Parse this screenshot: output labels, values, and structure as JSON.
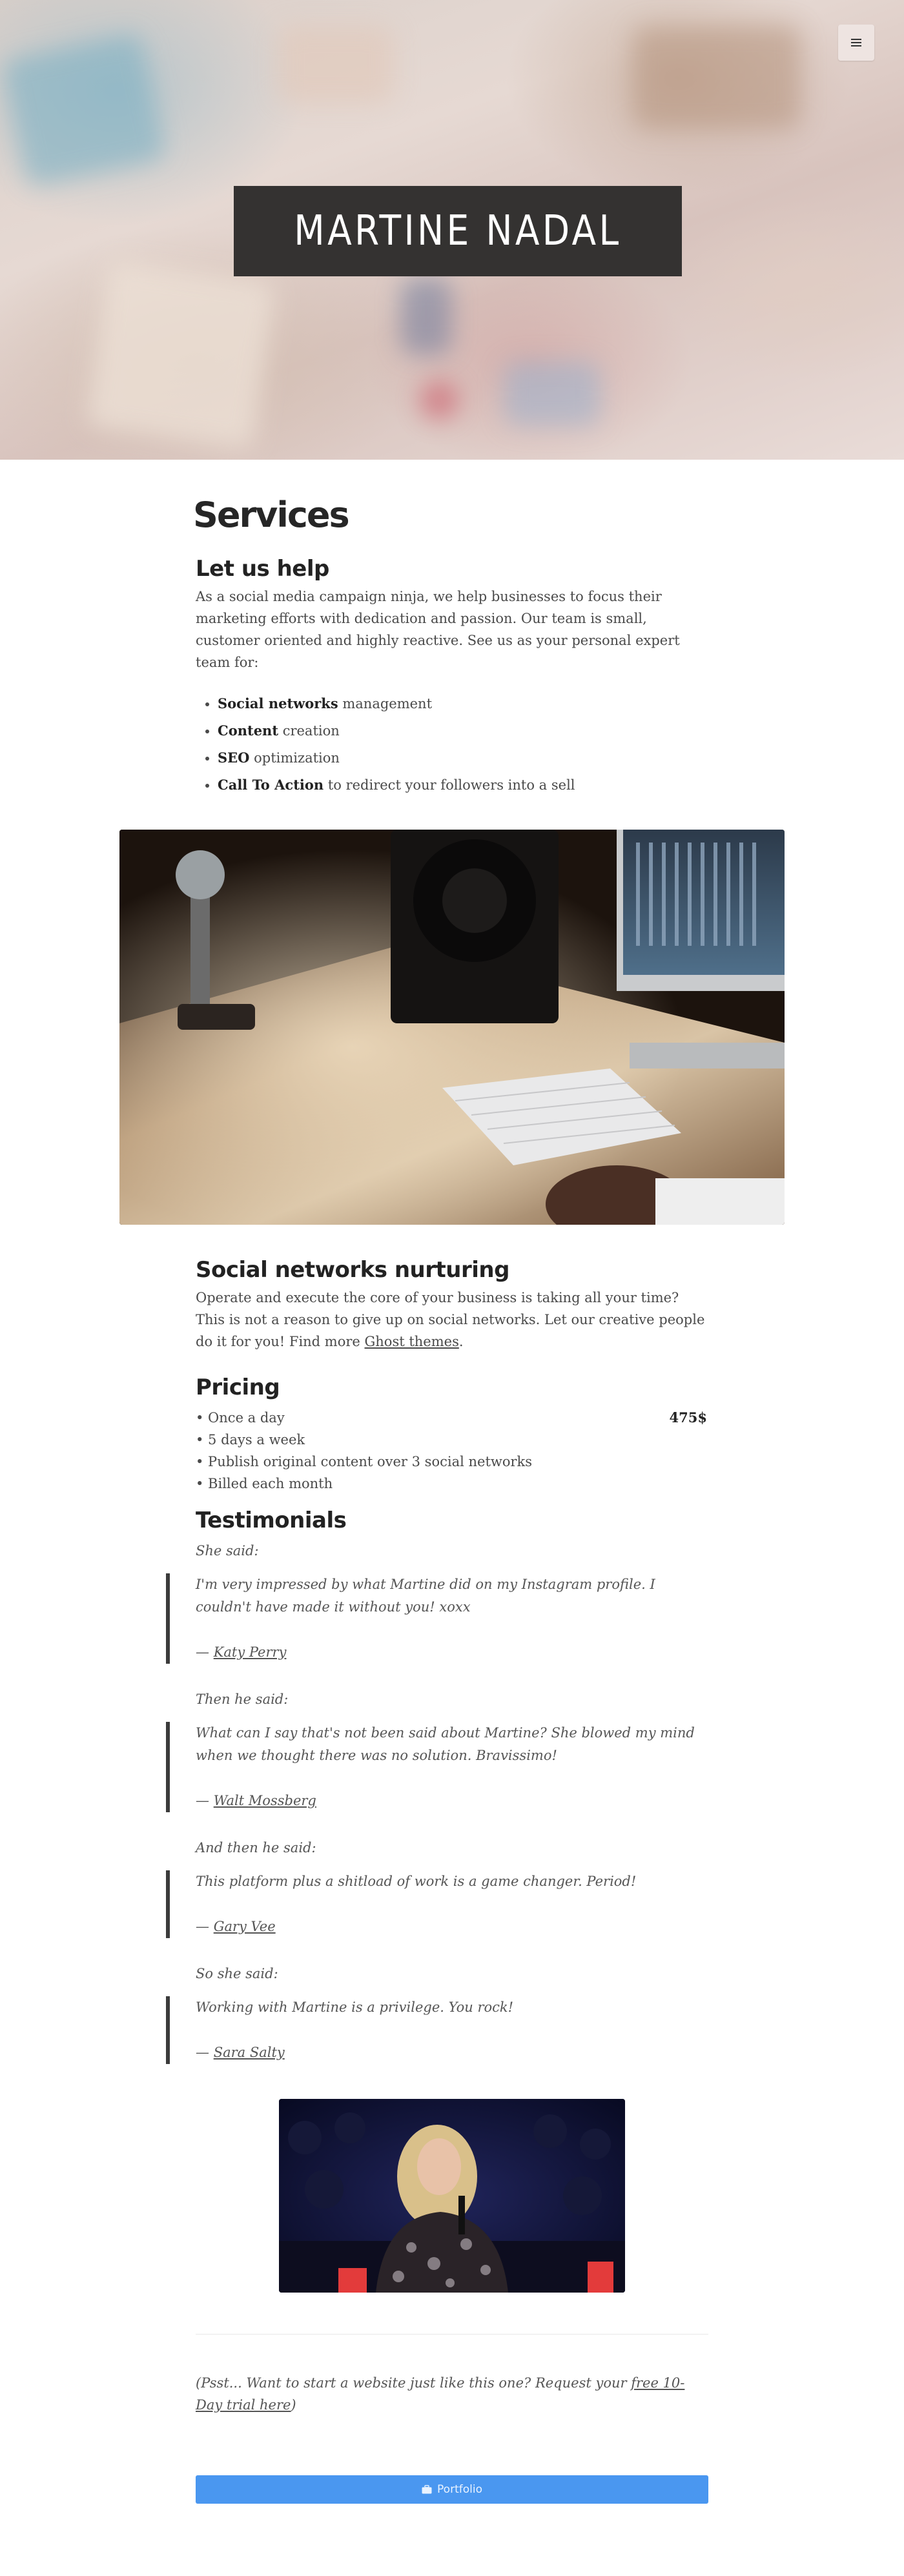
{
  "header": {
    "site_title": "MARTINE NADAL",
    "menu_icon": "hamburger-menu-icon"
  },
  "services": {
    "title": "Services",
    "let_us_help": {
      "heading": "Let us help",
      "paragraph": "As a social media campaign ninja, we help businesses to focus their marketing efforts with dedication and passion. Our team is small, customer oriented and highly reactive. See us as your personal expert team for:",
      "items": [
        {
          "bold": "Social networks",
          "rest": " management"
        },
        {
          "bold": "Content",
          "rest": " creation"
        },
        {
          "bold": "SEO",
          "rest": " optimization"
        },
        {
          "bold": "Call To Action",
          "rest": " to redirect your followers into a sell"
        }
      ]
    },
    "nurturing": {
      "heading": "Social networks nurturing",
      "paragraph_before": "Operate and execute the core of your business is taking all your time? This is not a reason to give up on social networks. Let our creative people do it for you! Find more ",
      "link": "Ghost themes",
      "paragraph_after": "."
    },
    "pricing": {
      "heading": "Pricing",
      "items": [
        "• Once a day",
        "• 5 days a week",
        "• Publish original content over 3 social networks",
        "• Billed each month"
      ],
      "price": "475$"
    },
    "testimonials": {
      "heading": "Testimonials",
      "entries": [
        {
          "intro": "She said:",
          "quote": "I'm very impressed by what Martine did on my Instagram profile. I couldn't have made it without you! xoxx",
          "dash": "— ",
          "author": "Katy Perry"
        },
        {
          "intro": "Then he said:",
          "quote": "What can I say that's not been said about Martine? She blowed my mind when we thought there was no solution. Bravissimo!",
          "dash": "— ",
          "author": "Walt Mossberg"
        },
        {
          "intro": "And then he said:",
          "quote": "This platform plus a shitload of work is a game changer. Period!",
          "dash": "— ",
          "author": "Gary Vee"
        },
        {
          "intro": "So she said:",
          "quote": "Working with Martine is a privilege. You rock!",
          "dash": "— ",
          "author": "Sara Salty"
        }
      ]
    }
  },
  "footer": {
    "psst_before": "(Psst... Want to start a website just like this one? Request your ",
    "psst_link": "free 10-Day trial here",
    "psst_after": ")",
    "portfolio_label": "Portfolio",
    "portfolio_icon": "briefcase-icon",
    "accent_color": "#4a97f0"
  }
}
